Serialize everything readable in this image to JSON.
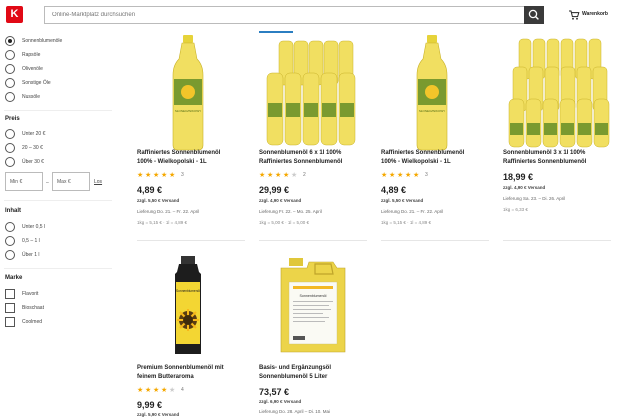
{
  "header": {
    "logo_letter": "K",
    "search_placeholder": "Online-Marktplatz durchsuchen",
    "cart_label": "Warenkorb"
  },
  "filters": {
    "type_options": [
      {
        "label": "Sonnenblumenöle",
        "selected": true
      },
      {
        "label": "Rapsöle",
        "selected": false
      },
      {
        "label": "Olivenöle",
        "selected": false
      },
      {
        "label": "Sonstige Öle",
        "selected": false
      },
      {
        "label": "Nussöle",
        "selected": false
      }
    ],
    "price_title": "Preis",
    "price_options": [
      "Unter 20 €",
      "20 – 30 €",
      "Über 30 €"
    ],
    "min_placeholder": "Min €",
    "max_placeholder": "Max €",
    "range_dash": "–",
    "apply_link": "Los",
    "content_title": "Inhalt",
    "content_options": [
      "Unter 0,5 l",
      "0,5 – 1 l",
      "Über 1 l"
    ],
    "brand_title": "Marke",
    "brand_options": [
      "Flavorit",
      "Bioschaat",
      "Coolmed"
    ]
  },
  "products": [
    {
      "name_line1": "Raffiniertes Sonnenblumenöl",
      "name_line2": "100% - Wielkopolski - 1L",
      "stars": 5,
      "rating_count": "3",
      "price": "4,89 €",
      "shipping": "zzgl. 5,50 € Versand",
      "delivery": "Lieferung Do. 21. – Fr. 22. April",
      "unit_price": "1kg = 5,15 € · 1l = 4,89 €"
    },
    {
      "name_line1": "Sonnenblumenöl 6 x 1l 100%",
      "name_line2": "Raffiniertes Sonnenblumenöl",
      "stars": 4,
      "rating_count": "2",
      "price": "29,99 €",
      "shipping": "zzgl. 4,90 € Versand",
      "delivery": "Lieferung Fr. 22. – Mo. 25. April",
      "unit_price": "1kg = 5,00 € · 1l = 5,00 €"
    },
    {
      "name_line1": "Raffiniertes Sonnenblumenöl",
      "name_line2": "100% - Wielkopolski - 1L",
      "stars": 5,
      "rating_count": "3",
      "price": "4,89 €",
      "shipping": "zzgl. 5,50 € Versand",
      "delivery": "Lieferung Do. 21. – Fr. 22. April",
      "unit_price": "1kg = 5,15 € · 1l = 4,89 €"
    },
    {
      "name_line1": "Sonnenblumenöl 3 x 1l 100%",
      "name_line2": "Raffiniertes Sonnenblumenöl",
      "stars": 0,
      "rating_count": "",
      "price": "18,99 €",
      "shipping": "zzgl. 4,90 € Versand",
      "delivery": "Lieferung Sa. 23. – Di. 26. April",
      "unit_price": "1kg = 6,33 €"
    },
    {
      "name_line1": "Premium Sonnenblumenöl mit",
      "name_line2": "feinem Butteraroma",
      "stars": 4,
      "rating_count": "4",
      "price": "9,99 €",
      "shipping": "zzgl. 5,90 € Versand",
      "delivery": "",
      "unit_price": ""
    },
    {
      "name_line1": "Basis- und Ergänzungsöl",
      "name_line2": "Sonnenblumenöl 5 Liter",
      "stars": 0,
      "rating_count": "",
      "price": "73,57 €",
      "shipping": "zzgl. 6,90 € Versand",
      "delivery": "Lieferung Do. 28. April – Di. 10. Mai",
      "unit_price": ""
    }
  ],
  "bottle_labels": {
    "bottle_small": "SŁONECZNIKOWY",
    "tin": "Sonnenblumenöl",
    "canister": "Sonnenblumenöl"
  },
  "colors": {
    "brand_red": "#e10915",
    "star_color": "#f5a800",
    "oil_yellow": "#e8d23a",
    "active_tab_blue": "#2b7ec1"
  }
}
